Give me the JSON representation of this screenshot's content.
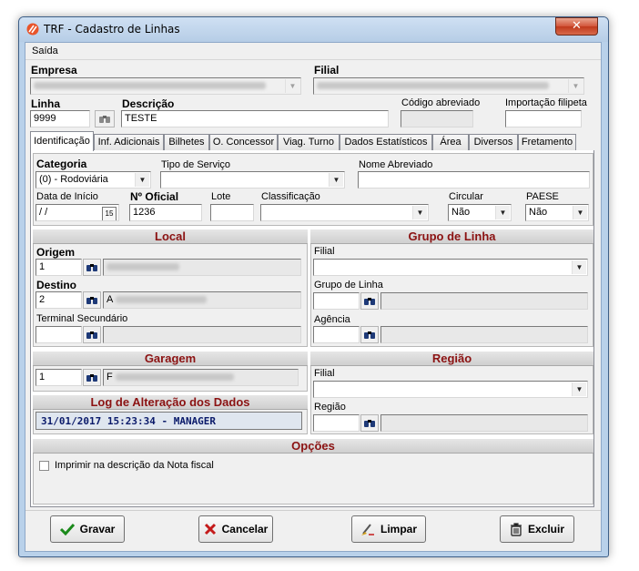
{
  "window": {
    "title": "TRF - Cadastro de Linhas",
    "close_label": "✕"
  },
  "menu": {
    "items": [
      "Saída"
    ]
  },
  "top": {
    "empresa_label": "Empresa",
    "filial_label": "Filial",
    "linha_label": "Linha",
    "linha_value": "9999",
    "descricao_label": "Descrição",
    "descricao_value": "TESTE",
    "codigo_abreviado_label": "Código abreviado",
    "importacao_label": "Importação filipeta"
  },
  "tabs": [
    "Identificação",
    "Inf. Adicionais",
    "Bilhetes",
    "O. Concessor",
    "Viag. Turno",
    "Dados Estatísticos",
    "Área",
    "Diversos",
    "Fretamento"
  ],
  "ident": {
    "categoria_label": "Categoria",
    "categoria_value": "(0) - Rodoviária",
    "tipo_servico_label": "Tipo de Serviço",
    "nome_abreviado_label": "Nome Abreviado",
    "data_inicio_label": "Data de Início",
    "data_inicio_value": " /  /",
    "calendar_label": "15",
    "n_oficial_label": "Nº Oficial",
    "n_oficial_value": "1236",
    "lote_label": "Lote",
    "classificacao_label": "Classificação",
    "circular_label": "Circular",
    "circular_value": "Não",
    "paese_label": "PAESE",
    "paese_value": "Não"
  },
  "local": {
    "header": "Local",
    "origem_label": "Origem",
    "origem_value": "1",
    "destino_label": "Destino",
    "destino_value": "2",
    "destino_desc_initial": "A",
    "terminal_label": "Terminal Secundário"
  },
  "grupo_linha": {
    "header": "Grupo de Linha",
    "filial_label": "Filial",
    "grupo_label": "Grupo de Linha",
    "agencia_label": "Agência"
  },
  "garagem": {
    "header": "Garagem",
    "value": "1",
    "desc_initial": "F"
  },
  "regiao": {
    "header": "Região",
    "filial_label": "Filial",
    "regiao_label": "Região"
  },
  "log": {
    "header": "Log de Alteração dos Dados",
    "value": "31/01/2017 15:23:34 - MANAGER"
  },
  "opcoes": {
    "header": "Opções",
    "imprimir_label": "Imprimir na descrição da Nota fiscal"
  },
  "buttons": {
    "gravar": "Gravar",
    "cancelar": "Cancelar",
    "limpar": "Limpar",
    "excluir": "Excluir"
  },
  "colors": {
    "header_text": "#8b1212",
    "log_text": "#0a1a6a",
    "window_frame": "#b9d1ea"
  }
}
